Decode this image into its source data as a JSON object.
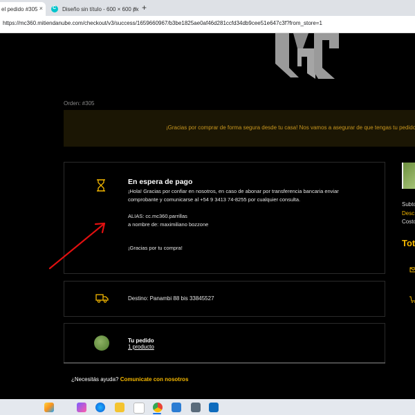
{
  "browser": {
    "tabs": [
      {
        "title": "el pedido #305 ·",
        "active": true
      },
      {
        "title": "Diseño sin título - 600 × 600 px",
        "active": false
      }
    ],
    "new_tab": "+",
    "close_glyph": "×",
    "url": "https://mc360.mitiendanube.com/checkout/v3/success/1659660967/b3be1825ae0af46d281ccfd34db9cee51e647c3f?from_store=1"
  },
  "order": {
    "label": "Orden: #305",
    "banner": "¡Gracias por comprar de forma segura desde tu casa! Nos vamos a asegurar de que tengas tu pedido lo"
  },
  "payment": {
    "title": "En espera de pago",
    "line1": "¡Hola! Gracias por confiar en nosotros, en caso de abonar por transferencia bancaria enviar",
    "line2": "comprobante y comunicarse al +54 9 3413 74-8255 por cualquier consulta.",
    "alias": "ALIAS:  cc.mc360.parrillas",
    "holder": "a nombre de:  maximiliano bozzone",
    "thanks": "¡Gracias por tu compra!"
  },
  "shipping": {
    "destino": "Destino: Panambi 88 bis 33845527"
  },
  "pedido": {
    "title": "Tu pedido",
    "link": "1 producto"
  },
  "help": {
    "question": "¿Necesitás ayuda?",
    "link": "Comunicate con nosotros"
  },
  "summary": {
    "subtotal": "Subto",
    "descuento": "Desc",
    "costo": "Costo",
    "total": "Tot"
  },
  "colors": {
    "accent": "#f5b800",
    "banner_bg": "#1b1604",
    "banner_text": "#c8961e",
    "annotation": "#e01010"
  },
  "icons": {
    "payment": "hourglass-icon",
    "shipping": "truck-icon",
    "contact": "envelope-icon",
    "cart": "cart-icon"
  }
}
